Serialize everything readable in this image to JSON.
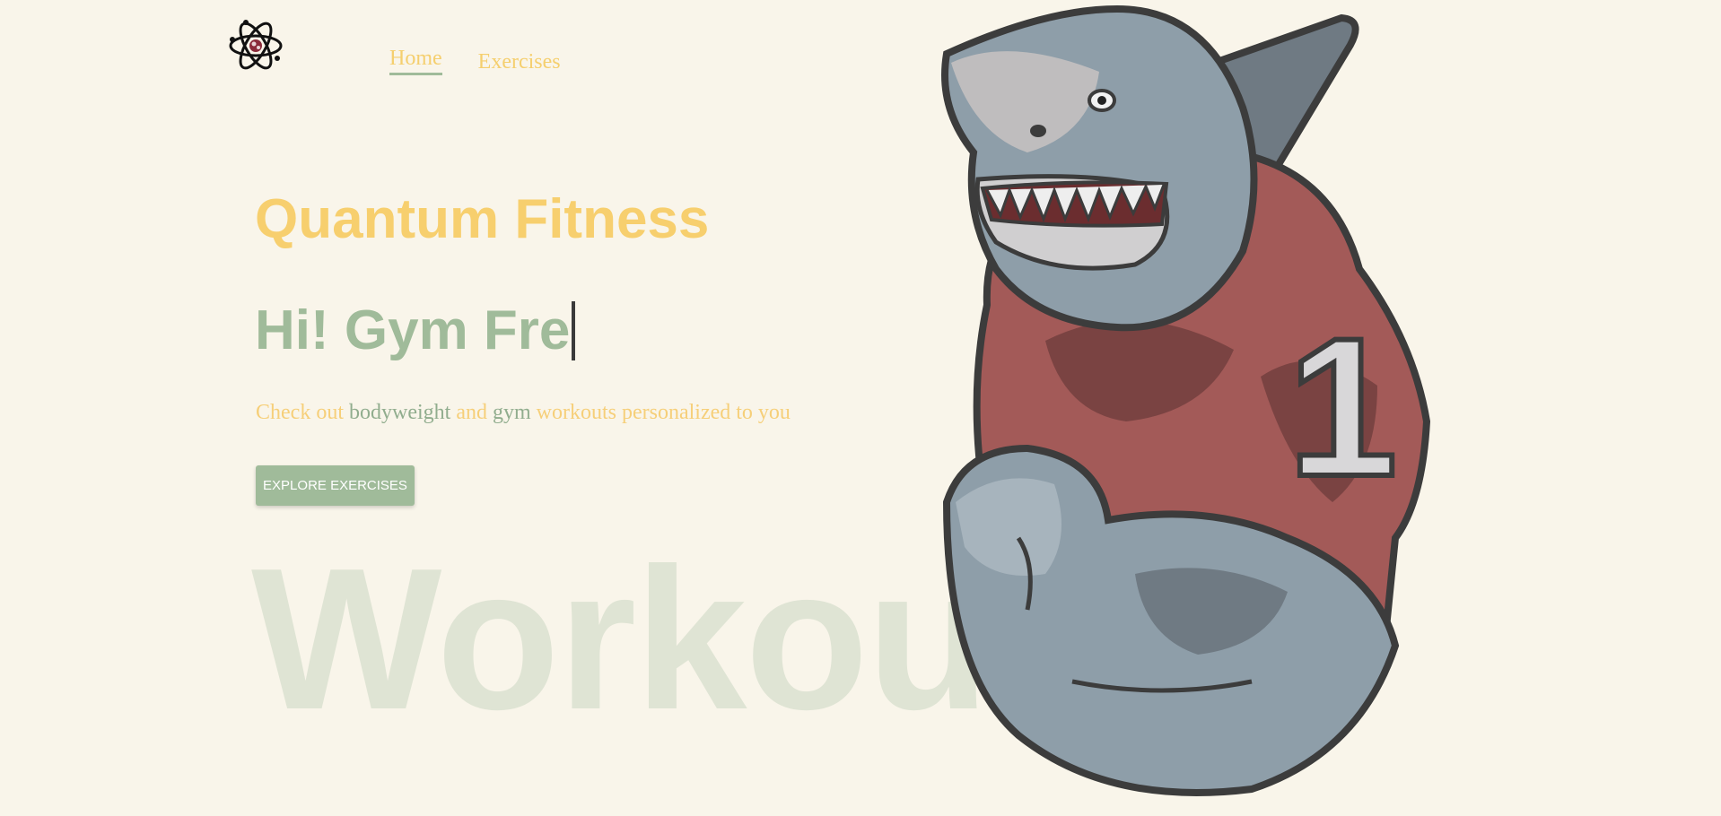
{
  "nav": {
    "home_label": "Home",
    "exercises_label": "Exercises",
    "active": "Home"
  },
  "hero": {
    "title": "Quantum Fitness",
    "greeting": "Hi! Gym Fre",
    "subtitle_parts": [
      "Check out ",
      "bodyweight",
      " and ",
      "gym",
      " workouts personalized to you"
    ],
    "cta_label": "EXPLORE EXERCISES",
    "background_word": "Workout"
  },
  "mascot": {
    "jersey_number": "1"
  },
  "colors": {
    "background": "#f9f5ea",
    "yellow": "#f7cf6e",
    "green": "#a0bb9a",
    "faded_green": "#dfe4d4",
    "jersey_red": "#a35a58",
    "shark_grey": "#8e9ea9"
  }
}
